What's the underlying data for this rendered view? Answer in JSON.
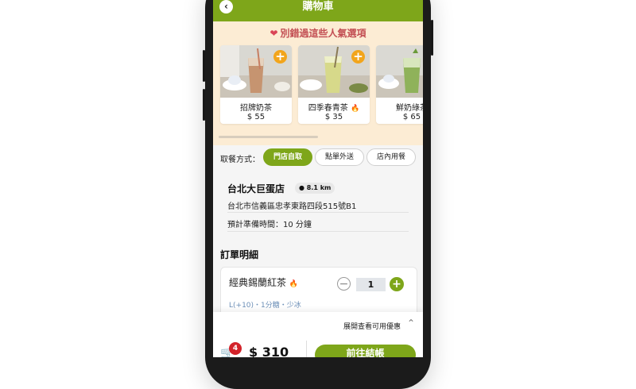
{
  "header": {
    "back_icon": "chevron-left-icon",
    "title": "購物車"
  },
  "popular": {
    "title": "別錯過這些人氣選項",
    "heart_icon": "heart-icon",
    "items": [
      {
        "name": "招牌奶茶",
        "price": "$ 55",
        "hot": false
      },
      {
        "name": "四季春青茶",
        "price": "$ 35",
        "hot": true
      },
      {
        "name": "鮮奶綠茶",
        "price": "$ 65",
        "hot": false
      }
    ]
  },
  "pickup": {
    "label": "取餐方式：",
    "options": [
      "門店自取",
      "點單外送",
      "店內用餐"
    ],
    "selected": "門店自取"
  },
  "store": {
    "name": "台北大巨蛋店",
    "distance": "8.1 km",
    "address": "台北市信義區忠孝東路四段515號B1",
    "prep_time": "預計準備時間：10 分鐘"
  },
  "order": {
    "title": "訂單明細",
    "items": [
      {
        "name": "經典錫蘭紅茶",
        "quantity": "1",
        "options": "L(+10)・1分糖・少冰",
        "hot": true
      }
    ]
  },
  "promo": {
    "text": "展開查看可用優惠"
  },
  "checkout": {
    "cart_count": "4",
    "total": "$ 310",
    "button_label": "前往結帳"
  },
  "colors": {
    "accent": "#7ea61a",
    "popular_bg": "#fcecd4",
    "add_button": "#f2a51c",
    "badge": "#d3232a"
  }
}
